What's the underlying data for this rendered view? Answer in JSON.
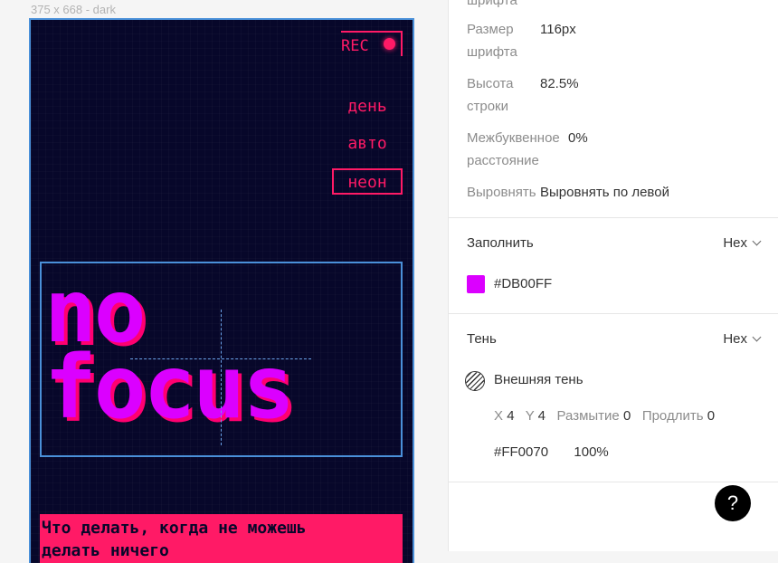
{
  "canvas": {
    "frame_label": "375 x 668 - dark",
    "rec_label": "REC",
    "modes": [
      "день",
      "авто",
      "неон"
    ],
    "active_mode": "неон",
    "title_line1": "no",
    "title_line2": "focus",
    "banner_line1": "Что делать, когда не можешь",
    "banner_line2": "делать ничего"
  },
  "panel": {
    "partial_top": "шрифта",
    "font_size": {
      "label1": "Размер",
      "label2": "шрифта",
      "value": "116px"
    },
    "line_height": {
      "label1": "Высота",
      "label2": "строки",
      "value": "82.5%"
    },
    "letter_spacing": {
      "label1": "Межбуквенное",
      "label2": "расстояние",
      "value": "0%"
    },
    "align": {
      "label": "Выровнять",
      "value": "Выровнять по левой"
    },
    "fill": {
      "title": "Заполнить",
      "format": "Hex",
      "color_hex": "#DB00FF",
      "color": "#db00ff"
    },
    "shadow": {
      "title": "Тень",
      "format": "Hex",
      "type": "Внешняя тень",
      "x_label": "X",
      "x_value": "4",
      "y_label": "Y",
      "y_value": "4",
      "blur_label": "Размытие",
      "blur_value": "0",
      "spread_label": "Продлить",
      "spread_value": "0",
      "color_hex": "#FF0070",
      "opacity": "100%"
    },
    "help_label": "?"
  },
  "colors": {
    "frame_bg": "#07072a",
    "accent_pink": "#ff1a66",
    "title_magenta": "#db00ff",
    "selection_blue": "#4a90d9"
  },
  "icons": [
    "rec-dot-icon",
    "chevron-down-icon",
    "shadow-hatch-icon",
    "help-icon"
  ]
}
